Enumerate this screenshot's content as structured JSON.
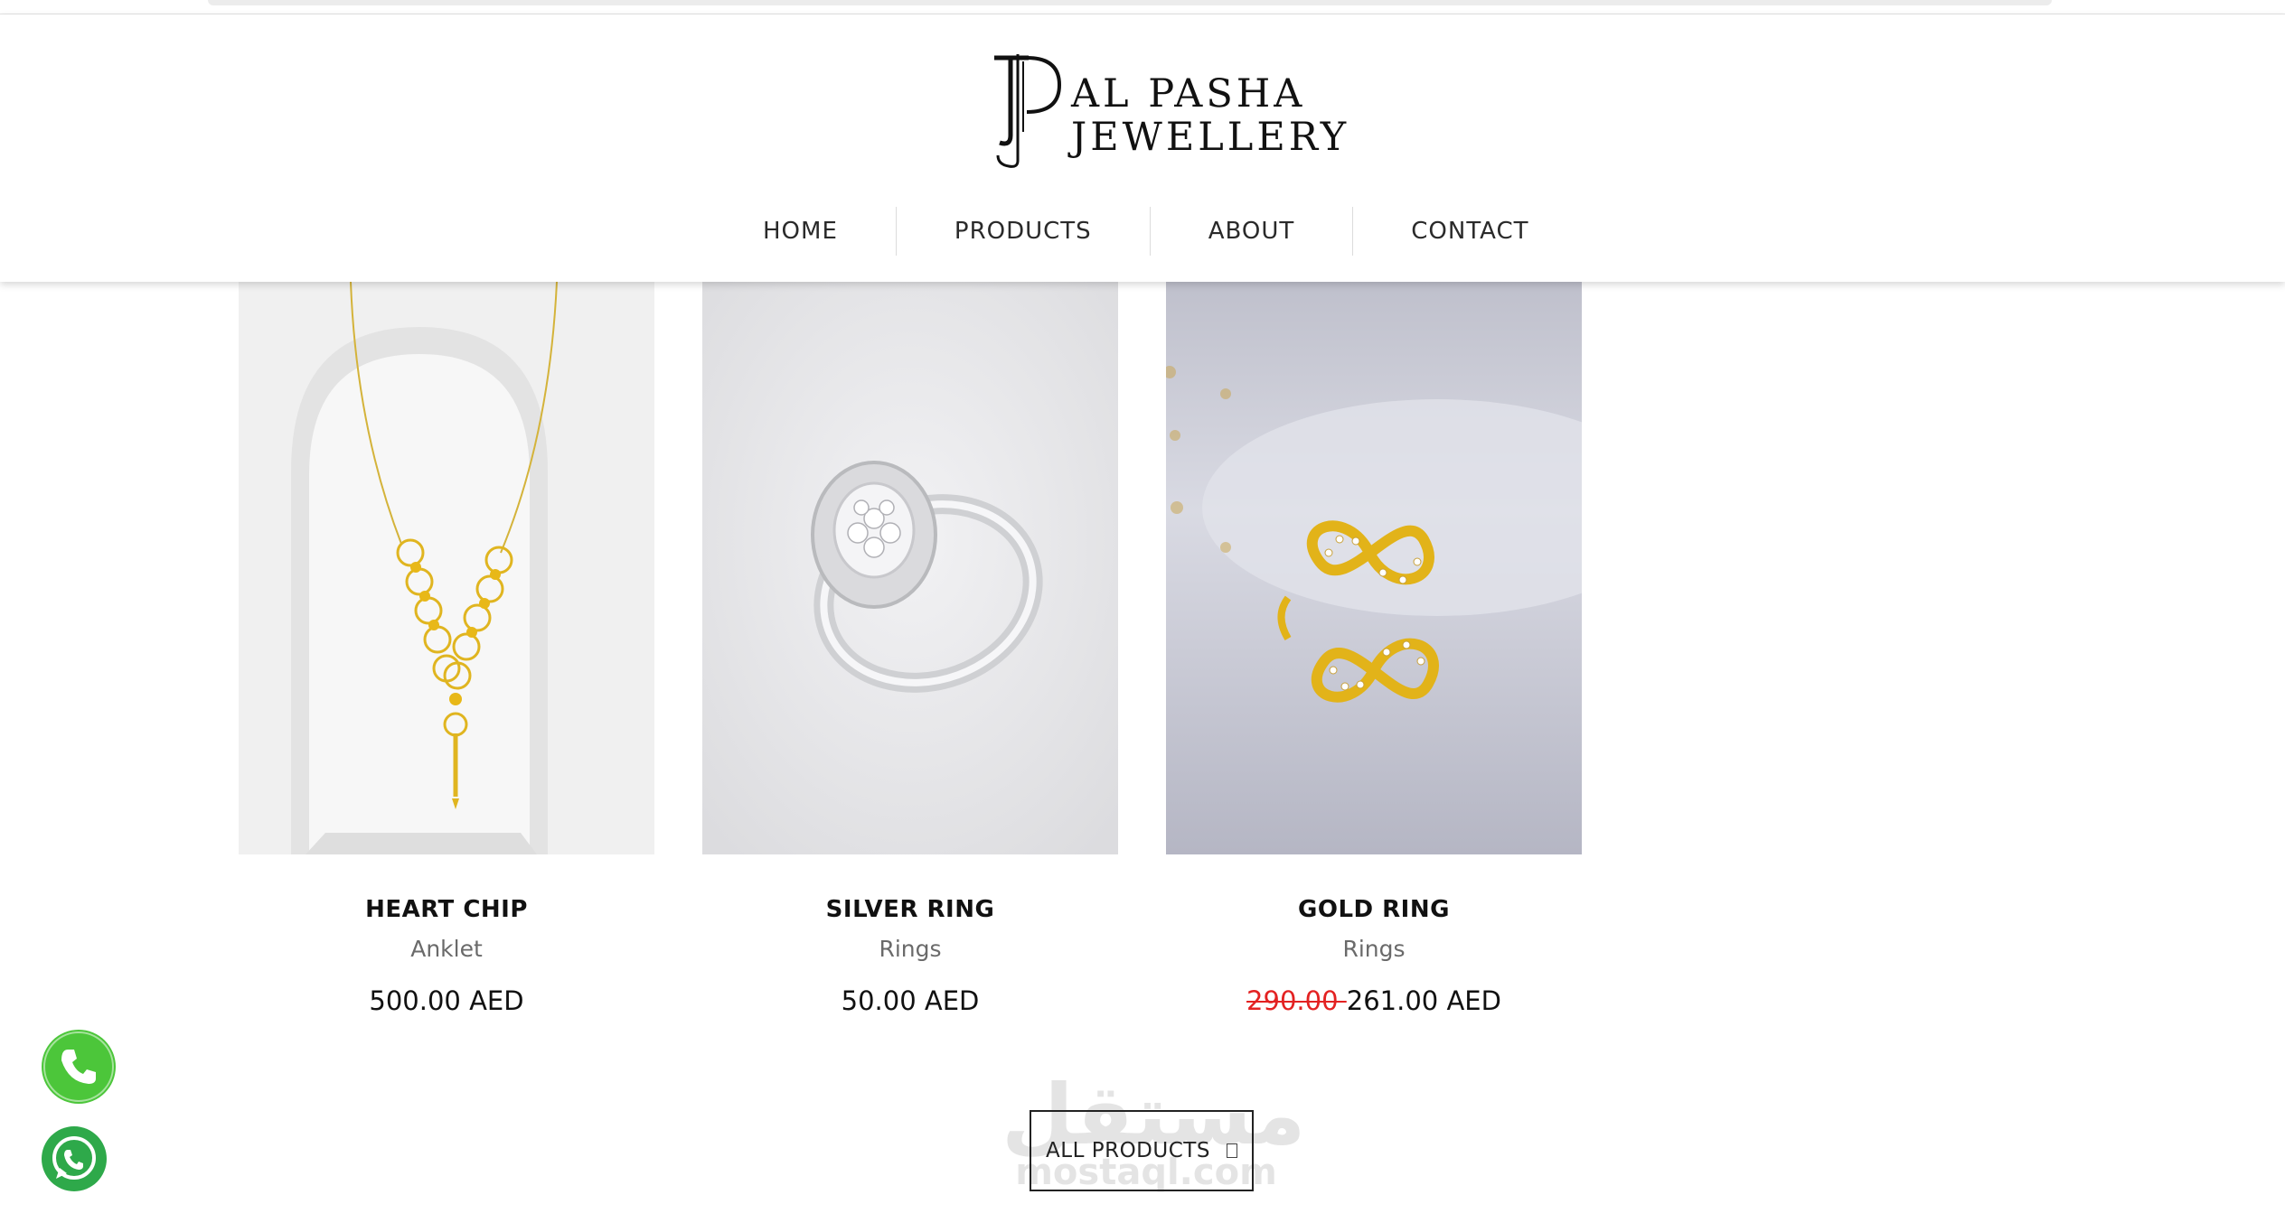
{
  "brand": {
    "logo_line1": "AL PASHA",
    "logo_line2": "JEWELLERY",
    "colors": {
      "text": "#111111",
      "accent_sale": "#e32222",
      "call_green": "#4cc63a",
      "whatsapp_green": "#2ea94a"
    }
  },
  "nav": {
    "items": [
      {
        "label": "HOME"
      },
      {
        "label": "PRODUCTS"
      },
      {
        "label": "ABOUT"
      },
      {
        "label": "CONTACT"
      }
    ]
  },
  "products": [
    {
      "name": "HEART CHIP",
      "category": "Anklet",
      "price": "500.00 AED",
      "old_price": ""
    },
    {
      "name": "SILVER RING",
      "category": "Rings",
      "price": "50.00 AED",
      "old_price": ""
    },
    {
      "name": "GOLD RING",
      "category": "Rings",
      "price": "261.00 AED",
      "old_price": "290.00 "
    }
  ],
  "all_products_button": {
    "label": "ALL PRODUCTS",
    "icon": "arrow-icon"
  },
  "floating_buttons": [
    {
      "name": "phone-call",
      "icon": "phone-icon"
    },
    {
      "name": "whatsapp",
      "icon": "whatsapp-icon"
    }
  ],
  "watermark": {
    "arabic": "مستقل",
    "latin": "mostaql.com"
  }
}
